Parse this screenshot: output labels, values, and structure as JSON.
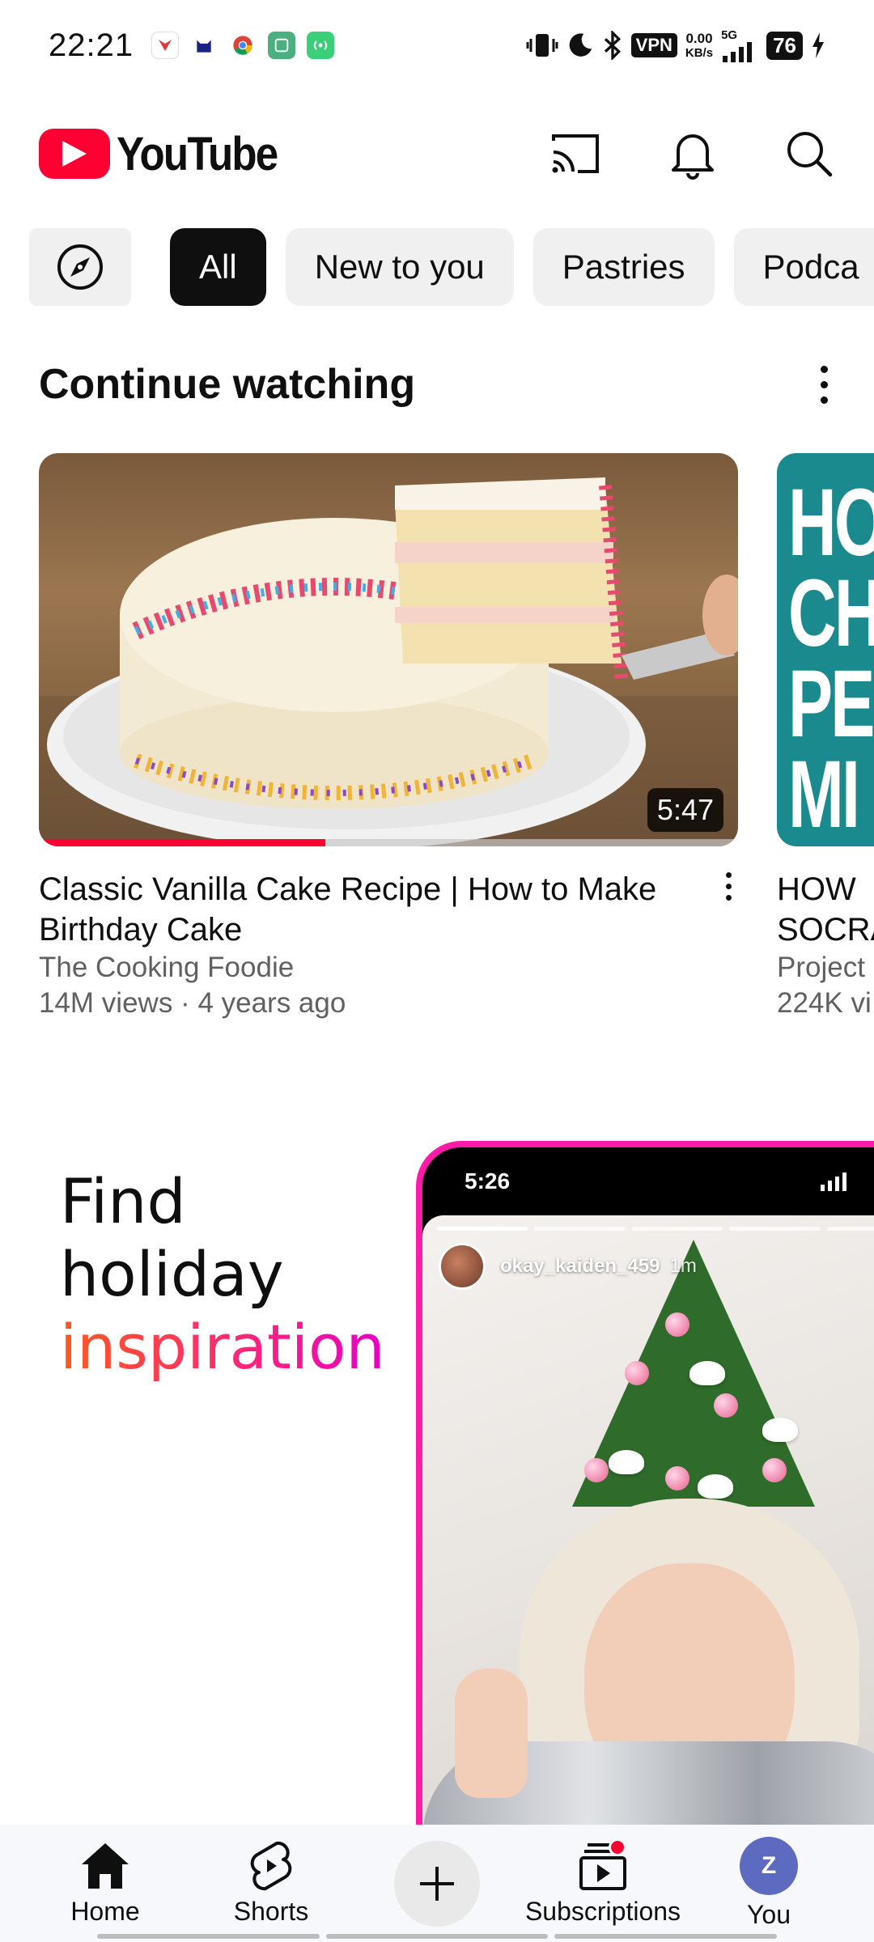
{
  "status_bar": {
    "time": "22:21",
    "vpn": "VPN",
    "net_speed_value": "0.00",
    "net_speed_unit": "KB/s",
    "network": "5G",
    "battery": "76"
  },
  "header": {
    "logo_text": "YouTube"
  },
  "chips": [
    {
      "label": "All",
      "active": true
    },
    {
      "label": "New to you",
      "active": false
    },
    {
      "label": "Pastries",
      "active": false
    },
    {
      "label": "Podca",
      "active": false
    }
  ],
  "continue_watching": {
    "title": "Continue watching",
    "videos": [
      {
        "title": "Classic Vanilla Cake Recipe | How to Make Birthday Cake",
        "channel": "The Cooking Foodie",
        "views": "14M views",
        "age": "4 years ago",
        "duration": "5:47",
        "progress": 0.41
      },
      {
        "title": "HOW ",
        "title_line2": "SOCRA",
        "channel": "Project",
        "views": "224K vi",
        "thumb_lines": [
          "HO",
          "CH",
          "PE",
          "MI"
        ]
      }
    ]
  },
  "promo": {
    "line1": "Find",
    "line2": "holiday",
    "line3": "inspiration",
    "phone_time": "5:26",
    "story_user": "okay_kaiden_459",
    "story_time": "1m"
  },
  "bottom_nav": {
    "home": "Home",
    "shorts": "Shorts",
    "subscriptions": "Subscriptions",
    "you": "You",
    "avatar_letter": "Z"
  },
  "colors": {
    "brand_red": "#ff0033",
    "chip_bg": "#f0f0f0",
    "secondary_text": "#606060",
    "avatar": "#5c6bc0"
  }
}
